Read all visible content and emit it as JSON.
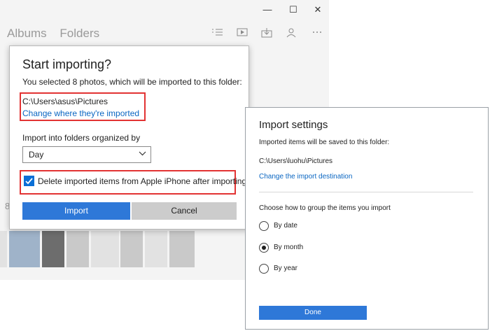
{
  "window": {
    "minimize_glyph": "—",
    "maximize_glyph": "☐",
    "close_glyph": "✕"
  },
  "nav": {
    "albums": "Albums",
    "folders": "Folders"
  },
  "toolbar_icons": [
    "select-icon",
    "slideshow-icon",
    "import-icon",
    "people-icon",
    "more-icon"
  ],
  "background": {
    "partial_number": "8"
  },
  "start_import": {
    "title": "Start importing?",
    "description": "You selected 8 photos, which will be imported to this folder:",
    "folder_path": "C:\\Users\\asus\\Pictures",
    "change_link": "Change where they're imported",
    "organize_label": "Import into folders organized by",
    "organize_value": "Day",
    "delete_checkbox_label": "Delete imported items from Apple iPhone after importing",
    "delete_checked": true,
    "import_button": "Import",
    "cancel_button": "Cancel",
    "highlight_color": "#e23333",
    "accent_color": "#2e78d8"
  },
  "import_settings": {
    "title": "Import settings",
    "description": "Imported items will be saved to this folder:",
    "folder_path": "C:\\Users\\luohu\\Pictures",
    "change_link": "Change the import destination",
    "group_label": "Choose how to group the items you import",
    "options": [
      {
        "label": "By date",
        "selected": false
      },
      {
        "label": "By month",
        "selected": true
      },
      {
        "label": "By year",
        "selected": false
      }
    ],
    "done_button": "Done"
  }
}
